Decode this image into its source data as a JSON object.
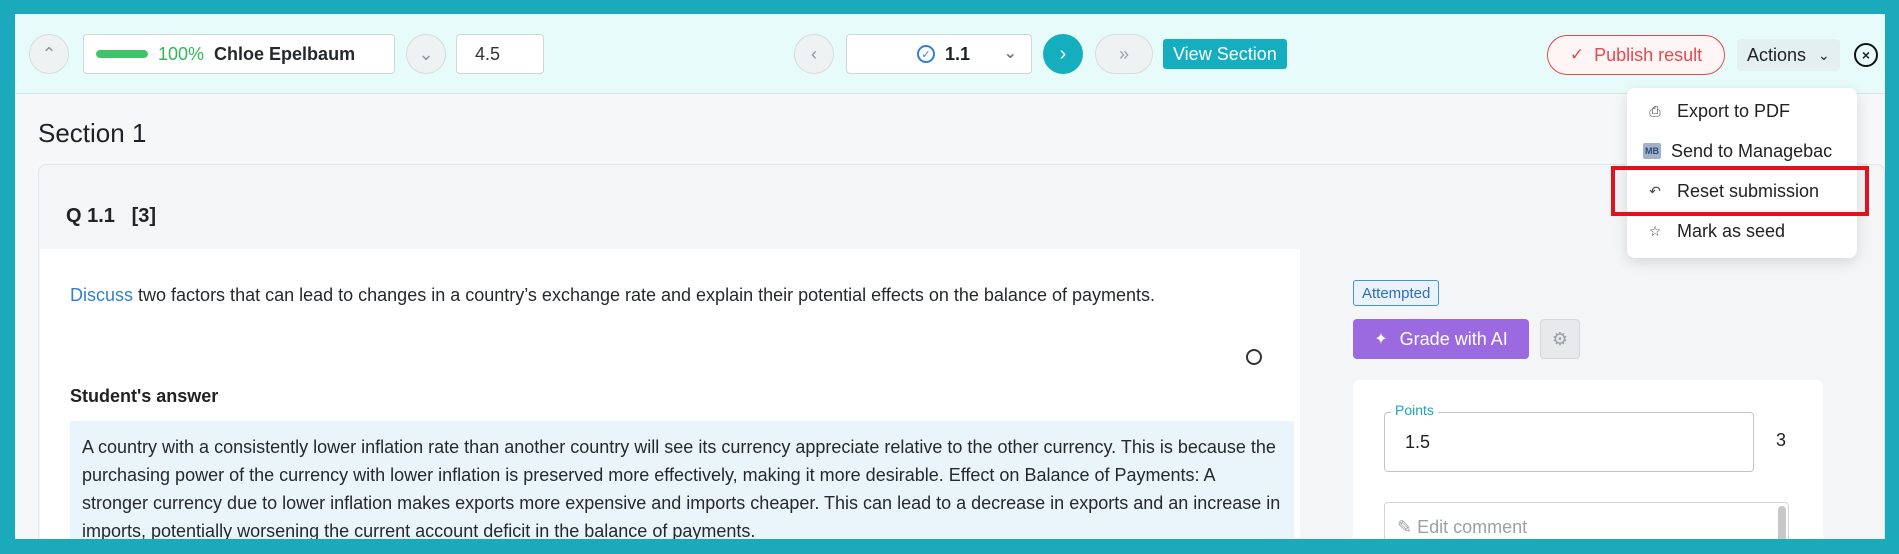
{
  "topbar": {
    "progress_pct": 100,
    "progress_label": "100%",
    "student_name": "Chloe Epelbaum",
    "score": "4.5",
    "question_selector": "1.1",
    "view_section_label": "View Section",
    "publish_label": "Publish result",
    "actions_label": "Actions"
  },
  "actions_menu": {
    "items": [
      {
        "label": "Export to PDF",
        "icon": "printer-icon"
      },
      {
        "label": "Send to Managebac",
        "icon": "managebac-icon",
        "icon_text": "MB"
      },
      {
        "label": "Reset submission",
        "icon": "reset-icon"
      },
      {
        "label": "Mark as seed",
        "icon": "star-icon"
      }
    ]
  },
  "section": {
    "title": "Section 1",
    "question_number": "Q 1.1",
    "question_marks": "[3]",
    "command_term": "Discuss",
    "prompt_rest": "two factors that can lead to changes in a country’s exchange rate and explain their potential effects on the balance of payments.",
    "answer_heading": "Student's answer",
    "answer_text": "A country with a consistently lower inflation rate than another country will see its currency appreciate relative to the other currency. This is because the purchasing power of the currency with lower inflation is preserved more effectively, making it more desirable. Effect on Balance of Payments: A stronger currency due to lower inflation makes exports more expensive and imports cheaper. This can lead to a decrease in exports and an increase in imports, potentially worsening the current account deficit in the balance of payments."
  },
  "grading": {
    "status_badge": "Attempted",
    "grade_ai_label": "Grade with AI",
    "points_label": "Points",
    "points_value": "1.5",
    "points_max": "3",
    "comment_placeholder": "Edit comment"
  },
  "colors": {
    "accent": "#15aebf",
    "publish": "#e5484d",
    "ai": "#9b6ae0",
    "highlight": "#e3101e"
  }
}
